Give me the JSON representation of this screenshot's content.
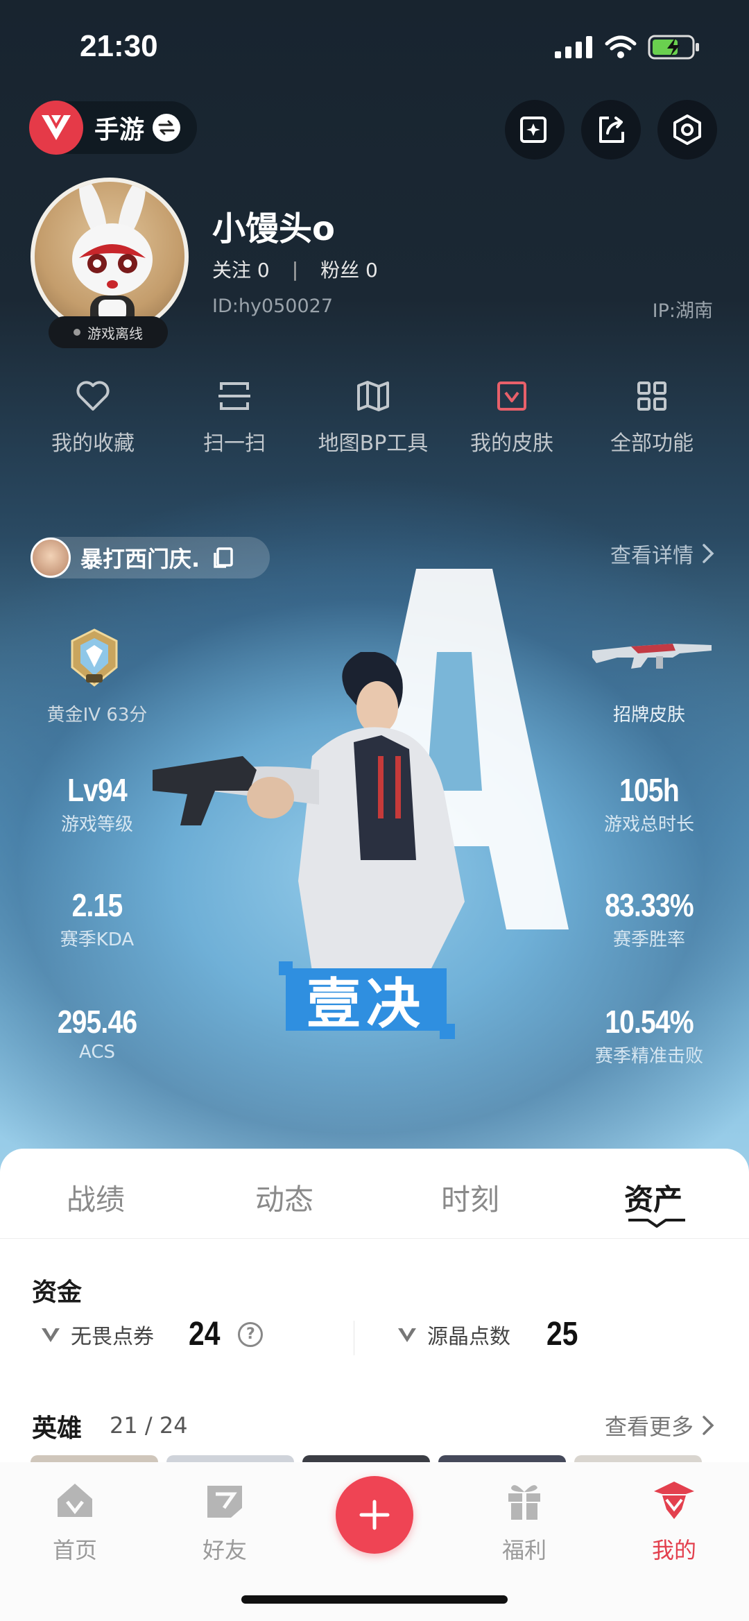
{
  "status_bar": {
    "time": "21:30"
  },
  "header": {
    "mode_label": "手游"
  },
  "profile": {
    "username": "小馒头o",
    "follow_label": "关注 0",
    "fans_label": "粉丝 0",
    "separator": "|",
    "id_label": "ID:hy050027",
    "ip_label": "IP:湖南",
    "status": "游戏离线"
  },
  "quick_actions": [
    {
      "label": "我的收藏",
      "icon": "heart-icon"
    },
    {
      "label": "扫一扫",
      "icon": "scan-icon"
    },
    {
      "label": "地图BP工具",
      "icon": "map-icon"
    },
    {
      "label": "我的皮肤",
      "icon": "skin-icon"
    },
    {
      "label": "全部功能",
      "icon": "grid-icon"
    }
  ],
  "player": {
    "name": "暴打西门庆.",
    "details_label": "查看详情",
    "rank": "黄金IV 63分",
    "skin_label": "招牌皮肤",
    "agent_name": "壹决"
  },
  "stats": {
    "level": {
      "value": "Lv94",
      "label": "游戏等级"
    },
    "hours": {
      "value": "105h",
      "label": "游戏总时长"
    },
    "kda": {
      "value": "2.15",
      "label": "赛季KDA"
    },
    "winrate": {
      "value": "83.33%",
      "label": "赛季胜率"
    },
    "acs": {
      "value": "295.46",
      "label": "ACS"
    },
    "headshot": {
      "value": "10.54%",
      "label": "赛季精准击败"
    }
  },
  "tabs": [
    "战绩",
    "动态",
    "时刻",
    "资产"
  ],
  "assets": {
    "funds_title": "资金",
    "vp_label": "无畏点券",
    "vp_value": "24",
    "help": "?",
    "rp_label": "源晶点数",
    "rp_value": "25",
    "heroes_title": "英雄",
    "heroes_count": "21 / 24",
    "more_label": "查看更多"
  },
  "tabbar": [
    {
      "label": "首页",
      "icon": "home-icon"
    },
    {
      "label": "好友",
      "icon": "friends-icon"
    },
    {
      "label": "福利",
      "icon": "gift-icon"
    },
    {
      "label": "我的",
      "icon": "profile-icon"
    }
  ],
  "colors": {
    "accent": "#e3404e",
    "fab": "#ef4454",
    "agent_badge": "#2f8fe0"
  }
}
